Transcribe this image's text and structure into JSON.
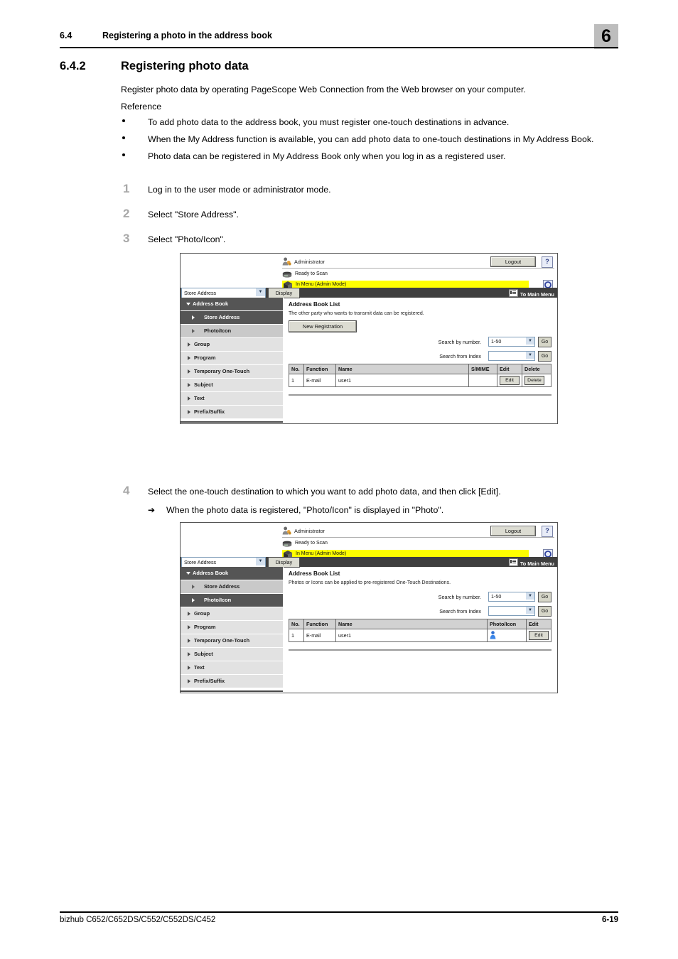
{
  "header": {
    "section_number": "6.4",
    "section_title": "Registering a photo in the address book",
    "chapter_marker": "6"
  },
  "section": {
    "number": "6.4.2",
    "title": "Registering photo data",
    "intro": "Register photo data by operating PageScope Web Connection from the Web browser on your computer.",
    "reference_label": "Reference",
    "bullets": [
      "To add photo data to the address book, you must register one-touch destinations in advance.",
      "When the My Address function is available, you can add photo data to one-touch destinations in My Address Book.",
      "Photo data can be registered in My Address Book only when you log in as a registered user."
    ],
    "steps": [
      {
        "number": "1",
        "text": "Log in to the user mode or administrator mode."
      },
      {
        "number": "2",
        "text": "Select \"Store Address\"."
      },
      {
        "number": "3",
        "text": "Select \"Photo/Icon\"."
      },
      {
        "number": "4",
        "text": "Select the one-touch destination to which you want to add photo data, and then click [Edit].",
        "substep_arrow": "➔",
        "substep": "When the photo data is registered, \"Photo/Icon\" is displayed in \"Photo\"."
      }
    ]
  },
  "figure1": {
    "user_name": "Administrator",
    "logout_label": "Logout",
    "help_label": "?",
    "status_line1": "Ready to Scan",
    "status_line2": "In Menu (Admin Mode)",
    "nav_select_value": "Store Address",
    "display_label": "Display",
    "to_main_menu": "To Main Menu",
    "sidebar": [
      {
        "label": "Address Book",
        "level": "root",
        "active": false
      },
      {
        "label": "Store Address",
        "level": "sub",
        "active": true
      },
      {
        "label": "Photo/Icon",
        "level": "sub",
        "active": false
      },
      {
        "label": "Group",
        "level": "item",
        "active": false
      },
      {
        "label": "Program",
        "level": "item",
        "active": false
      },
      {
        "label": "Temporary One-Touch",
        "level": "item",
        "active": false
      },
      {
        "label": "Subject",
        "level": "item",
        "active": false
      },
      {
        "label": "Text",
        "level": "item",
        "active": false
      },
      {
        "label": "Prefix/Suffix",
        "level": "item",
        "active": false
      }
    ],
    "main_title": "Address Book List",
    "main_desc": "The other party who wants to transmit data can be registered.",
    "new_registration_label": "New Registration",
    "search_by_number_label": "Search by number.",
    "search_by_number_value": "1-50",
    "search_from_index_label": "Search from Index",
    "search_from_index_value": "",
    "go_label": "Go",
    "table_headers": [
      "No.",
      "Function",
      "Name",
      "S/MIME",
      "Edit",
      "Delete"
    ],
    "table_row": {
      "no": "1",
      "function": "E-mail",
      "name": "user1",
      "smime": "",
      "edit_label": "Edit",
      "delete_label": "Delete"
    }
  },
  "figure2": {
    "user_name": "Administrator",
    "logout_label": "Logout",
    "help_label": "?",
    "status_line1": "Ready to Scan",
    "status_line2": "In Menu (Admin Mode)",
    "nav_select_value": "Store Address",
    "display_label": "Display",
    "to_main_menu": "To Main Menu",
    "sidebar": [
      {
        "label": "Address Book",
        "level": "root",
        "active": false
      },
      {
        "label": "Store Address",
        "level": "sub",
        "active": false
      },
      {
        "label": "Photo/Icon",
        "level": "sub",
        "active": true
      },
      {
        "label": "Group",
        "level": "item",
        "active": false
      },
      {
        "label": "Program",
        "level": "item",
        "active": false
      },
      {
        "label": "Temporary One-Touch",
        "level": "item",
        "active": false
      },
      {
        "label": "Subject",
        "level": "item",
        "active": false
      },
      {
        "label": "Text",
        "level": "item",
        "active": false
      },
      {
        "label": "Prefix/Suffix",
        "level": "item",
        "active": false
      }
    ],
    "main_title": "Address Book List",
    "main_desc": "Photos or Icons can be applied to pre-registered One-Touch Destinations.",
    "search_by_number_label": "Search by number.",
    "search_by_number_value": "1-50",
    "search_from_index_label": "Search from Index",
    "search_from_index_value": "",
    "go_label": "Go",
    "table_headers": [
      "No.",
      "Function",
      "Name",
      "Photo/Icon",
      "Edit"
    ],
    "table_row": {
      "no": "1",
      "function": "E-mail",
      "name": "user1",
      "photo_icon": "person-icon",
      "edit_label": "Edit"
    }
  },
  "footer": {
    "left": "bizhub C652/C652DS/C552/C552DS/C452",
    "right": "6-19"
  },
  "colors": {
    "highlight": "#ffff00",
    "navbar": "#3f3f3f",
    "sidebar_active": "#555555",
    "chapter_marker": "#bdbdbd",
    "step_number": "#a8a8a8"
  }
}
